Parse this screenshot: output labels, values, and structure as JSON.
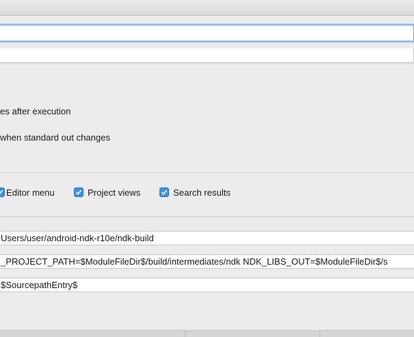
{
  "window": {
    "title": ""
  },
  "fields": {
    "name_value": "",
    "second_value": ""
  },
  "options": {
    "sync_after_execution": "es after execution",
    "open_console": "when standard out changes"
  },
  "show_in": {
    "editor_menu": {
      "label": "Editor menu",
      "checked": true
    },
    "project_views": {
      "label": "Project views",
      "checked": true
    },
    "search_results": {
      "label": "Search results",
      "checked": true
    }
  },
  "tool_settings": {
    "program": "Users/user/android-ndk-r10e/ndk-build",
    "parameters": "_PROJECT_PATH=$ModuleFileDir$/build/intermediates/ndk NDK_LIBS_OUT=$ModuleFileDir$/s",
    "working_directory": "$SourcepathEntry$"
  },
  "colors": {
    "accent": "#3a8fe6",
    "focus_ring": "#a9c8ef"
  }
}
